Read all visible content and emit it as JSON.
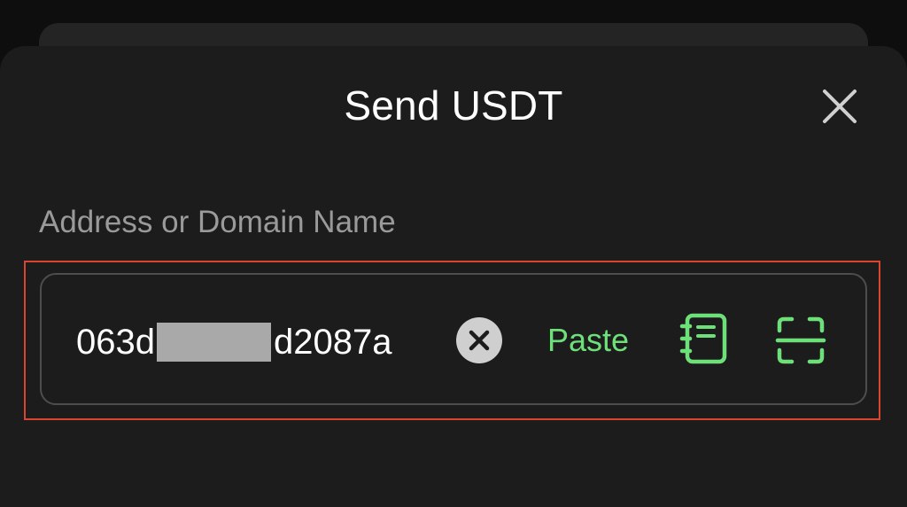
{
  "sheet": {
    "title": "Send USDT"
  },
  "address_field": {
    "label": "Address or Domain Name",
    "value_prefix": "063d",
    "value_suffix": "d2087a",
    "value_redacted": true
  },
  "actions": {
    "paste_label": "Paste"
  },
  "icons": {
    "close": "close-icon",
    "clear": "clear-icon",
    "address_book": "address-book-icon",
    "scan": "scan-icon"
  },
  "colors": {
    "background": "#1c1c1c",
    "accent_green": "#6ee07a",
    "highlight_red": "#d9452f",
    "text_primary": "#ffffff",
    "text_secondary": "#9a9a9a"
  }
}
